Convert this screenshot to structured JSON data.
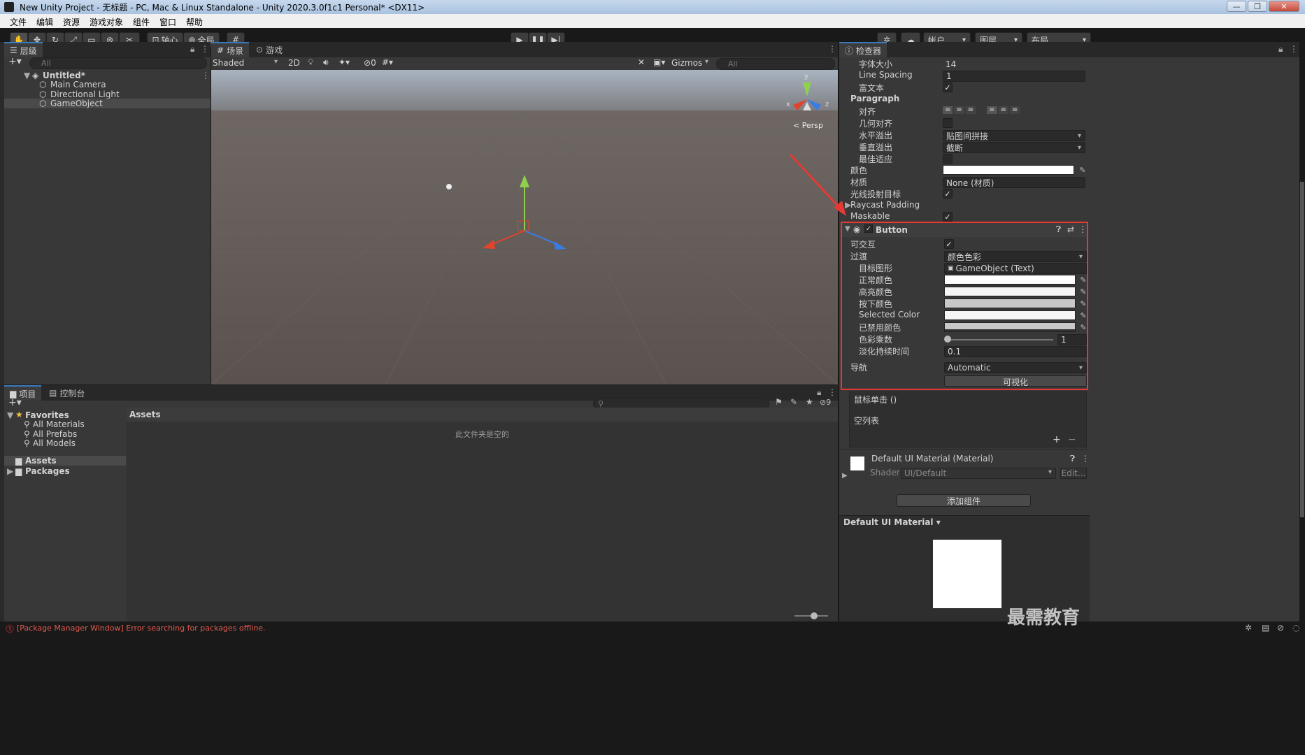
{
  "window": {
    "title": "New Unity Project - 无标题 - PC, Mac & Linux Standalone - Unity 2020.3.0f1c1 Personal* <DX11>",
    "min": "—",
    "max": "❐",
    "close": "✕"
  },
  "menu": [
    "文件",
    "编辑",
    "资源",
    "游戏对象",
    "组件",
    "窗口",
    "帮助"
  ],
  "toolbar": {
    "pivot": "轴心",
    "global": "全局",
    "account": "帐户",
    "layers": "图层",
    "layout": "布局"
  },
  "hierarchy": {
    "tab": "层级",
    "search_placeholder": "All",
    "scene": "Untitled*",
    "items": [
      "Main Camera",
      "Directional Light",
      "GameObject"
    ]
  },
  "scene": {
    "tab_scene": "场景",
    "tab_game": "游戏",
    "shading": "Shaded",
    "mode2d": "2D",
    "hidden_count": "0",
    "gizmos": "Gizmos",
    "search_placeholder": "All",
    "persp": "< Persp",
    "axis_y": "y",
    "axis_x": "x",
    "axis_z": "z"
  },
  "project": {
    "tab_project": "项目",
    "tab_console": "控制台",
    "favorites": "Favorites",
    "fav_items": [
      "All Materials",
      "All Prefabs",
      "All Models"
    ],
    "assets": "Assets",
    "packages": "Packages",
    "breadcrumb": "Assets",
    "empty_msg": "此文件夹是空的",
    "hidden_count": "9"
  },
  "inspector": {
    "tab": "检查器",
    "font_size_label": "字体大小",
    "font_size": "14",
    "line_spacing_label": "Line Spacing",
    "line_spacing": "1",
    "rich_text_label": "富文本",
    "paragraph": "Paragraph",
    "align_label": "对齐",
    "geo_align_label": "几何对齐",
    "h_overflow_label": "水平溢出",
    "h_overflow": "贴图间拼接",
    "v_overflow_label": "垂直溢出",
    "v_overflow": "截断",
    "best_fit_label": "最佳适应",
    "color_label": "颜色",
    "material_label": "材质",
    "material": "None (材质)",
    "raycast_label": "光线投射目标",
    "raycast_padding": "Raycast Padding",
    "maskable": "Maskable",
    "button": {
      "title": "Button",
      "interactable_label": "可交互",
      "transition_label": "过渡",
      "transition": "颜色色彩",
      "target_label": "目标图形",
      "target": "GameObject (Text)",
      "normal_label": "正常颜色",
      "highlight_label": "高亮颜色",
      "pressed_label": "按下颜色",
      "selected_label": "Selected Color",
      "disabled_label": "已禁用颜色",
      "multiplier_label": "色彩乘数",
      "multiplier": "1",
      "fade_label": "淡化持续时间",
      "fade": "0.1",
      "nav_label": "导航",
      "nav": "Automatic",
      "visualize": "可视化"
    },
    "onclick": "鼠标单击 ()",
    "empty_list": "空列表",
    "plus": "+",
    "minus": "−",
    "material_name": "Default UI Material (Material)",
    "shader_label": "Shader",
    "shader": "UI/Default",
    "edit": "Edit...",
    "add_component": "添加组件",
    "preview_title": "Default UI Material ▾"
  },
  "status": {
    "error": "[Package Manager Window] Error searching for packages offline."
  },
  "watermark": "最需教育",
  "colors": {
    "highlight_box": "#e53935",
    "arrow": "#e53935",
    "accent": "#3a79bb"
  }
}
